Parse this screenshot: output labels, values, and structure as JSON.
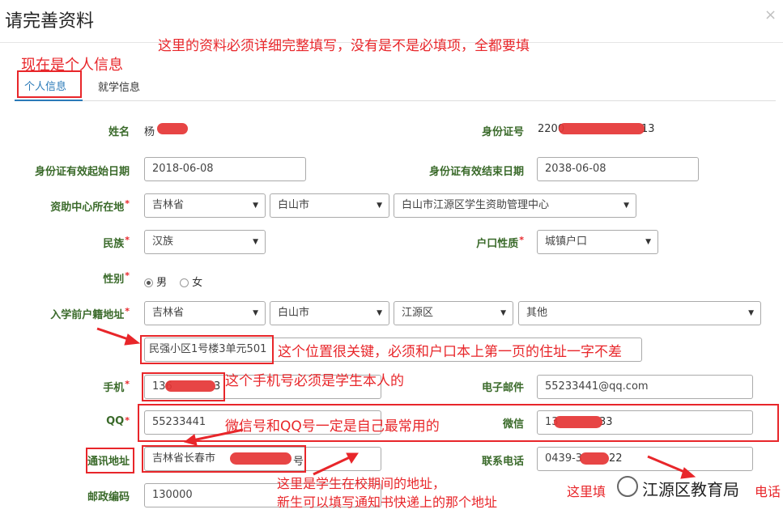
{
  "dialog": {
    "title": "请完善资料",
    "close": "×"
  },
  "notes": {
    "top": "这里的资料必须详细完整填写，没有是不是必填项，全都要填",
    "current": "现在是个人信息",
    "address": "这个位置很关键，必须和户口本上第一页的住址一字不差",
    "phone": "这个手机号必须是学生本人的",
    "wechat_qq": "微信号和QQ号一定是自己最常用的",
    "contact_addr_1": "这里是学生在校期间的地址，",
    "contact_addr_2": "新生可以填写通知书快递上的那个地址",
    "contact_phone": "这里填",
    "contact_phone_tail": "电话"
  },
  "tabs": [
    "个人信息",
    "就学信息"
  ],
  "form": {
    "name": {
      "label": "姓名",
      "value": "杨"
    },
    "idcard": {
      "label": "身份证号",
      "value_prefix": "2200",
      "value_suffix": "13"
    },
    "id_start": {
      "label": "身份证有效起始日期",
      "value": "2018-06-08"
    },
    "id_end": {
      "label": "身份证有效结束日期",
      "value": "2038-06-08"
    },
    "center": {
      "label": "资助中心所在地",
      "province": "吉林省",
      "city": "白山市",
      "center": "白山市江源区学生资助管理中心"
    },
    "ethnicity": {
      "label": "民族",
      "value": "汉族"
    },
    "hukou_type": {
      "label": "户口性质",
      "value": "城镇户口"
    },
    "gender": {
      "label": "性别",
      "options": [
        "男",
        "女"
      ],
      "selected": "男"
    },
    "origin": {
      "label": "入学前户籍地址",
      "province": "吉林省",
      "city": "白山市",
      "district": "江源区",
      "town": "其他",
      "detail": "民强小区1号楼3单元501"
    },
    "mobile": {
      "label": "手机",
      "value": "136",
      "value_tail": "3"
    },
    "email": {
      "label": "电子邮件",
      "value": "55233441@qq.com"
    },
    "qq": {
      "label": "QQ",
      "value": "55233441"
    },
    "wechat": {
      "label": "微信",
      "value": "13",
      "value_tail": "33"
    },
    "contact_address": {
      "label": "通讯地址",
      "value": "吉林省长春市",
      "value_tail": "号"
    },
    "contact_phone": {
      "label": "联系电话",
      "value": "0439-3",
      "value_tail": "22"
    },
    "postcode": {
      "label": "邮政编码",
      "value": "130000"
    }
  },
  "watermark": {
    "text": "江源区教育局"
  },
  "colors": {
    "annotation": "#e8262a",
    "label": "#3a6a2a",
    "tab_active": "#2a7ab8"
  }
}
